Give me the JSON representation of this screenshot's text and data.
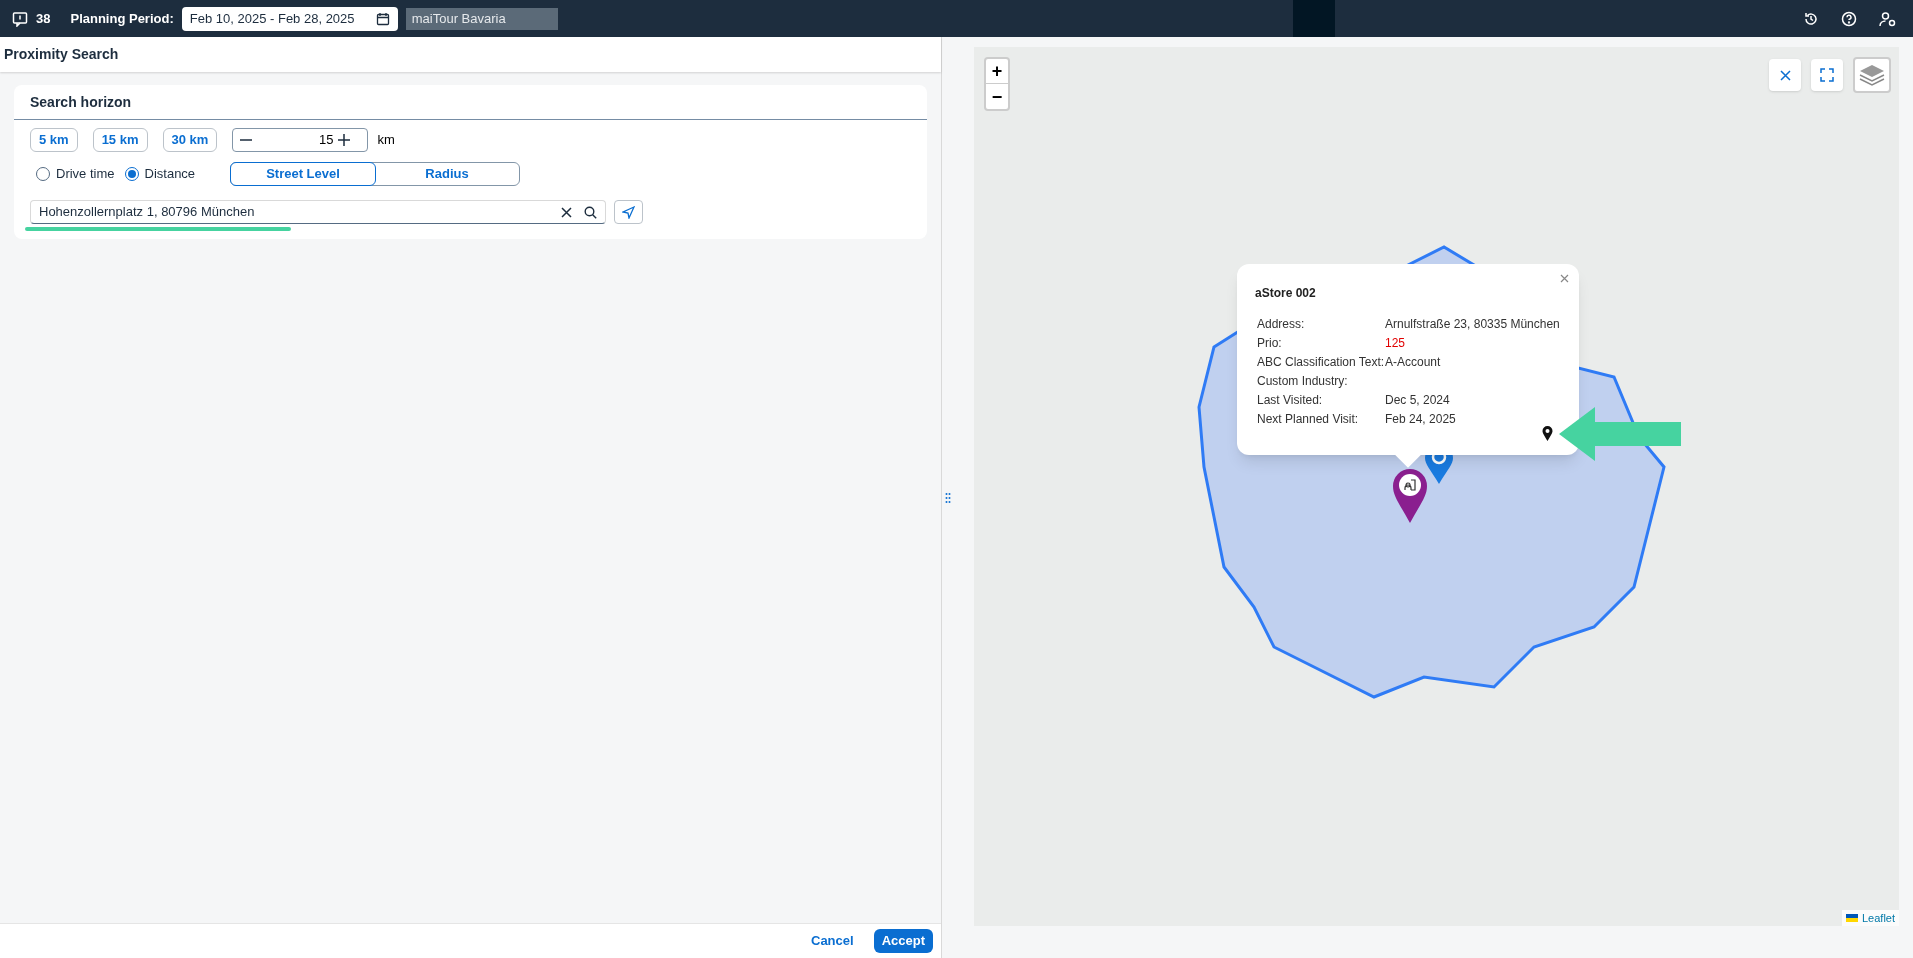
{
  "top_bar": {
    "count": "38",
    "planning_label": "Planning Period:",
    "date_range": "Feb 10, 2025 - Feb 28, 2025",
    "tour": "maiTour Bavaria"
  },
  "panel": {
    "title": "Proximity Search",
    "section_title": "Search horizon",
    "presets": [
      "5 km",
      "15 km",
      "30 km"
    ],
    "stepper": {
      "value": "15",
      "unit": "km"
    },
    "modes": [
      {
        "label": "Drive time",
        "selected": false
      },
      {
        "label": "Distance",
        "selected": true
      }
    ],
    "segments": [
      {
        "label": "Street Level",
        "selected": true
      },
      {
        "label": "Radius",
        "selected": false
      }
    ],
    "address": {
      "value": "Hohenzollernplatz 1, 80796 München"
    },
    "buttons": [
      {
        "label": "Cancel",
        "kind": "transparent"
      },
      {
        "label": "Accept",
        "kind": "emphasized"
      }
    ]
  },
  "map": {
    "zoom_in": "+",
    "zoom_out": "−",
    "attribution": "Leaflet",
    "popup": {
      "title": "aStore 002",
      "rows": [
        {
          "label": "Address:",
          "value": "Arnulfstraße 23, 80335 München",
          "highlight": false
        },
        {
          "label": "Prio:",
          "value": "125",
          "highlight": true
        },
        {
          "label": "ABC Classification Text:",
          "value": "A-Account",
          "highlight": false
        },
        {
          "label": "Custom Industry:",
          "highlight": false
        },
        {
          "label": "Last Visited:",
          "value": "Dec 5, 2024",
          "highlight": false
        },
        {
          "label": "Next Planned Visit:",
          "value": "Feb 24, 2025",
          "highlight": false
        }
      ]
    }
  }
}
